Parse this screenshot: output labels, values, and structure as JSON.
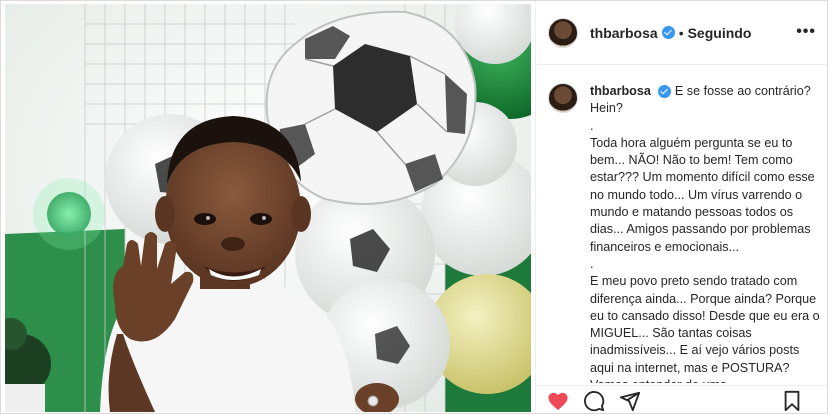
{
  "header": {
    "username": "thbarbosa",
    "separator": "•",
    "follow_status": "Seguindo",
    "more_label": "•••"
  },
  "caption": {
    "username": "thbarbosa",
    "lines": [
      "E se fosse ao contrário? Hein?",
      ".",
      "Toda hora alguém pergunta se eu to bem... NÃO! Não to bem! Tem como estar??? Um momento difícil como esse no mundo todo... Um vírus varrendo o mundo e matando pessoas todos os dias... Amigos passando por problemas financeiros e emocionais...",
      ".",
      "E meu povo preto sendo tratado com diferença ainda... Porque ainda? Porque eu to cansado disso! Desde que eu era o MIGUEL... São tantas coisas inadmissíveis... E aí vejo vários posts aqui na internet, mas e POSTURA? Vamos entender de uma"
    ]
  },
  "icons": {
    "like": "heart-icon",
    "comment": "comment-icon",
    "share": "share-icon",
    "save": "bookmark-icon"
  },
  "colors": {
    "like": "#ed4956",
    "verified": "#3897f0",
    "text": "#262626",
    "balloon_green": "#1f8a3a",
    "balloon_yellow": "#e3de8c"
  }
}
